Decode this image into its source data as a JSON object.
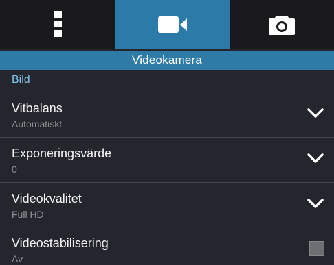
{
  "tabs": [
    {
      "name": "menu-icon",
      "active": false
    },
    {
      "name": "video-camera-icon",
      "active": true
    },
    {
      "name": "camera-icon",
      "active": false
    }
  ],
  "header": {
    "title": "Videokamera"
  },
  "section": {
    "label": "Bild"
  },
  "settings": [
    {
      "title": "Vitbalans",
      "value": "Automatiskt",
      "control": "dropdown"
    },
    {
      "title": "Exponeringsvärde",
      "value": "0",
      "control": "dropdown"
    },
    {
      "title": "Videokvalitet",
      "value": "Full HD",
      "control": "dropdown"
    },
    {
      "title": "Videostabilisering",
      "value": "Av",
      "control": "checkbox",
      "checked": false
    }
  ],
  "colors": {
    "accent": "#2f7ba8",
    "section_label": "#7fc6ee",
    "background": "#25262d"
  }
}
